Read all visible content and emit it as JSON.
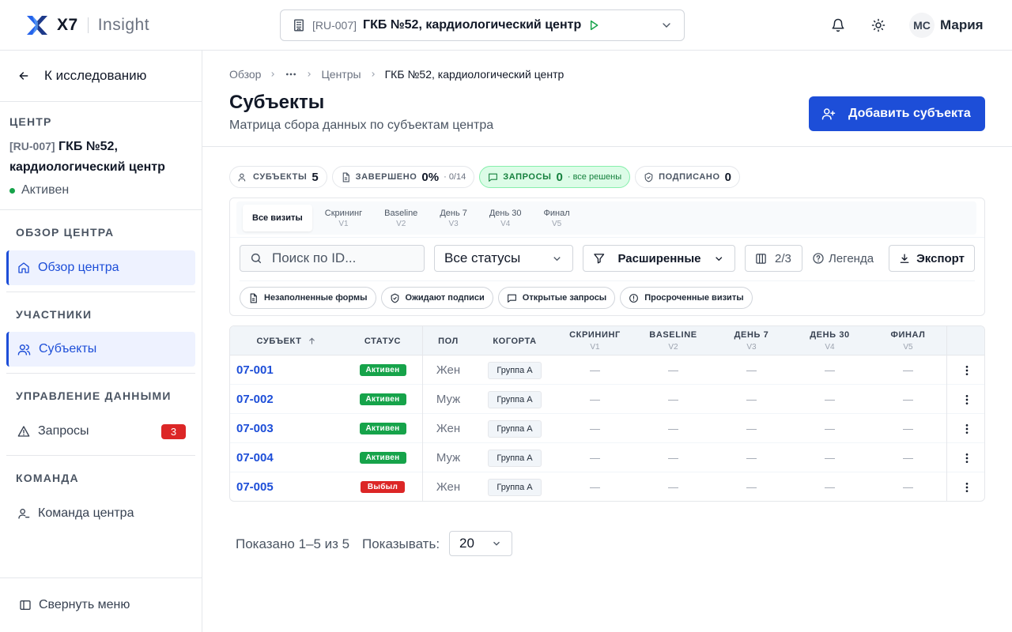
{
  "app": {
    "brand": "X7",
    "product": "Insight",
    "logo_icon": "x7-logo"
  },
  "header": {
    "center_code": "[RU-007]",
    "center_name": "ГКБ №52, кардиологический центр",
    "user_initials": "МС",
    "user_name": "Мария"
  },
  "sidebar": {
    "back_label": "К исследованию",
    "center_section": "ЦЕНТР",
    "center_code": "[RU-007]",
    "center_name": "ГКБ №52, кардиологический центр",
    "center_status": "Активен",
    "sections": {
      "overview": "ОБЗОР ЦЕНТРА",
      "participants": "УЧАСТНИКИ",
      "data": "УПРАВЛЕНИЕ ДАННЫМИ",
      "team": "КОМАНДА"
    },
    "items": {
      "overview": "Обзор центра",
      "subjects": "Субъекты",
      "queries": "Запросы",
      "queries_badge": "3",
      "team": "Команда центра"
    },
    "collapse_label": "Свернуть меню"
  },
  "breadcrumb": [
    "Обзор",
    "Центры",
    "ГКБ №52, кардиологический центр"
  ],
  "page": {
    "title": "Субъекты",
    "subtitle": "Матрица сбора данных по субъектам центра",
    "add_button": "Добавить субъекта"
  },
  "stats": {
    "subjects": {
      "label": "СУБЪЕКТЫ",
      "value": "5"
    },
    "completed": {
      "label": "ЗАВЕРШЕНО",
      "value": "0%",
      "extra": "· 0/14"
    },
    "queries": {
      "label": "ЗАПРОСЫ",
      "value": "0",
      "extra": "· все решены"
    },
    "signed": {
      "label": "ПОДПИСАНО",
      "value": "0"
    }
  },
  "tabs": [
    {
      "label": "Все визиты",
      "sub": ""
    },
    {
      "label": "Скрининг",
      "sub": "V1"
    },
    {
      "label": "Baseline",
      "sub": "V2"
    },
    {
      "label": "День 7",
      "sub": "V3"
    },
    {
      "label": "День 30",
      "sub": "V4"
    },
    {
      "label": "Финал",
      "sub": "V5"
    }
  ],
  "filters": {
    "search_placeholder": "Поиск по ID...",
    "status_value": "Все статусы",
    "advanced_label": "Расширенные",
    "columns_label": "2/3",
    "legend_label": "Легенда",
    "export_label": "Экспорт"
  },
  "quick_filters": [
    "Незаполненные формы",
    "Ожидают подписи",
    "Открытые запросы",
    "Просроченные визиты"
  ],
  "table": {
    "headers": {
      "subject": "СУБЪЕКТ",
      "status": "СТАТУС",
      "sex": "ПОЛ",
      "cohort": "КОГОРТА",
      "v1": "СКРИНИНГ",
      "v1_sub": "V1",
      "v2": "BASELINE",
      "v2_sub": "V2",
      "v3": "ДЕНЬ 7",
      "v3_sub": "V3",
      "v4": "ДЕНЬ 30",
      "v4_sub": "V4",
      "v5": "ФИНАЛ",
      "v5_sub": "V5"
    },
    "rows": [
      {
        "id": "07-001",
        "status": "Активен",
        "status_type": "active",
        "sex": "Жен",
        "cohort": "Группа А",
        "v1": "—",
        "v2": "—",
        "v3": "—",
        "v4": "—",
        "v5": "—"
      },
      {
        "id": "07-002",
        "status": "Активен",
        "status_type": "active",
        "sex": "Муж",
        "cohort": "Группа А",
        "v1": "—",
        "v2": "—",
        "v3": "—",
        "v4": "—",
        "v5": "—"
      },
      {
        "id": "07-003",
        "status": "Активен",
        "status_type": "active",
        "sex": "Жен",
        "cohort": "Группа А",
        "v1": "—",
        "v2": "—",
        "v3": "—",
        "v4": "—",
        "v5": "—"
      },
      {
        "id": "07-004",
        "status": "Активен",
        "status_type": "active",
        "sex": "Муж",
        "cohort": "Группа А",
        "v1": "—",
        "v2": "—",
        "v3": "—",
        "v4": "—",
        "v5": "—"
      },
      {
        "id": "07-005",
        "status": "Выбыл",
        "status_type": "out",
        "sex": "Жен",
        "cohort": "Группа А",
        "v1": "—",
        "v2": "—",
        "v3": "—",
        "v4": "—",
        "v5": "—"
      }
    ]
  },
  "pagination": {
    "info": "Показано 1–5 из 5",
    "per_page_label": "Показывать:",
    "per_page": "20"
  },
  "colors": {
    "accent": "#1d4ed8",
    "success": "#16a34a",
    "danger": "#dc2626"
  }
}
